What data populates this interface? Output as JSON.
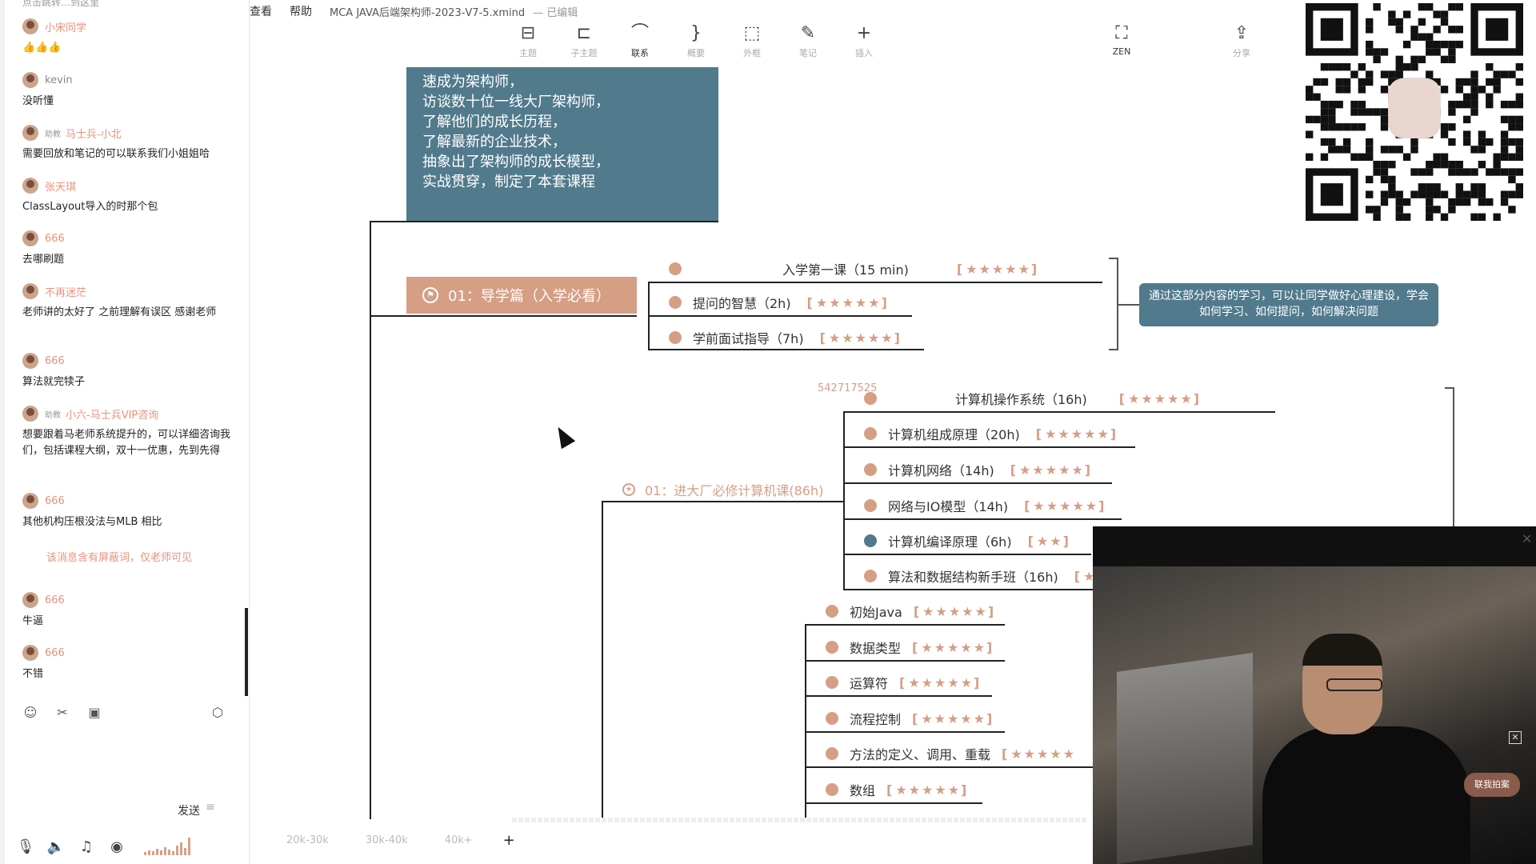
{
  "chat": {
    "top_partial": "点击跳转…到这里",
    "messages": [
      {
        "name": "小宋同学",
        "text": "👍👍👍"
      },
      {
        "name": "kevin",
        "text": "没听懂"
      },
      {
        "badge": "助教",
        "name": "马士兵-小北",
        "text": "需要回放和笔记的可以联系我们小姐姐哈"
      },
      {
        "name": "张天琪",
        "text": "ClassLayout导入的时那个包"
      },
      {
        "name": "666",
        "text": "去哪刷题"
      },
      {
        "name": "不再迷茫",
        "text": "老师讲的太好了 之前理解有误区 感谢老师"
      },
      {
        "name": "666",
        "text": "算法就完犊子"
      },
      {
        "badge": "助教",
        "name": "小六-马士兵VIP咨询",
        "text": "想要跟着马老师系统提升的，可以详细咨询我们，包括课程大纲，双十一优惠，先到先得"
      },
      {
        "name": "666",
        "text": "其他机构压根没法与MLB 相比"
      },
      {
        "system": "该消息含有屏蔽词，仅老师可见"
      },
      {
        "name": "666",
        "text": "牛逼"
      },
      {
        "name": "666",
        "text": "不错"
      }
    ],
    "send_label": "发送",
    "send_sep": "≡"
  },
  "menu": {
    "items": [
      "查看",
      "帮助"
    ],
    "doc_title": "MCA JAVA后端架构师-2023-V7-5.xmind",
    "status": "— 已编辑"
  },
  "toolbar": {
    "items": [
      {
        "icon": "topic-icon",
        "glyph": "⊟",
        "label": "主题"
      },
      {
        "icon": "subtopic-icon",
        "glyph": "⊏",
        "label": "子主题"
      },
      {
        "icon": "relationship-icon",
        "glyph": "⌒",
        "label": "联系"
      },
      {
        "icon": "summary-icon",
        "glyph": "}",
        "label": "概要"
      },
      {
        "icon": "boundary-icon",
        "glyph": "⬚",
        "label": "外框"
      },
      {
        "icon": "note-icon",
        "glyph": "✎",
        "label": "笔记"
      },
      {
        "icon": "insert-icon",
        "glyph": "+",
        "label": "插入"
      },
      {
        "icon": "zen-icon",
        "glyph": "⛶",
        "label": "ZEN"
      },
      {
        "icon": "share-icon",
        "glyph": "⇪",
        "label": "分享"
      }
    ]
  },
  "map": {
    "intro_lines": [
      "速成为架构师，",
      "访谈数十位一线大厂架构师，",
      "了解他们的成长历程，",
      "了解最新的企业技术，",
      "抽象出了架构师的成长模型，",
      "实战贯穿，制定了本套课程"
    ],
    "section1": "01：导学篇（入学必看）",
    "section1_topics": [
      {
        "title": "入学第一课（15 min)",
        "stars": "★★★★★"
      },
      {
        "title": "提问的智慧（2h)",
        "stars": "★★★★★"
      },
      {
        "title": "学前面试指导（7h)",
        "stars": "★★★★★"
      }
    ],
    "note": "通过这部分内容的学习，可以让同学做好心理建设，学会如何学习、如何提问，如何解决问题",
    "number_label": "542717525",
    "section2": "01：进大厂必修计算机课(86h)",
    "section2_topics": [
      {
        "title": "计算机操作系统（16h)",
        "stars": "★★★★★"
      },
      {
        "title": "计算机组成原理（20h)",
        "stars": "★★★★★"
      },
      {
        "title": "计算机网络（14h)",
        "stars": "★★★★★"
      },
      {
        "title": "网络与IO模型（14h)",
        "stars": "★★★★★"
      },
      {
        "title": "计算机编译原理（6h)",
        "stars": "★★"
      },
      {
        "title": "算法和数据结构新手班（16h)",
        "stars": "★"
      }
    ],
    "java_topics": [
      {
        "title": "初始Java",
        "stars": "★★★★★"
      },
      {
        "title": "数据类型",
        "stars": "★★★★★"
      },
      {
        "title": "运算符",
        "stars": "★★★★★"
      },
      {
        "title": "流程控制",
        "stars": "★★★★★"
      },
      {
        "title": "方法的定义、调用、重载",
        "stars": "★★★★★"
      },
      {
        "title": "数组",
        "stars": "★★★★★"
      }
    ]
  },
  "sheets": [
    "20k-30k",
    "30k-40k",
    "40k+"
  ],
  "webcam": {
    "logo": "联我拍案"
  }
}
